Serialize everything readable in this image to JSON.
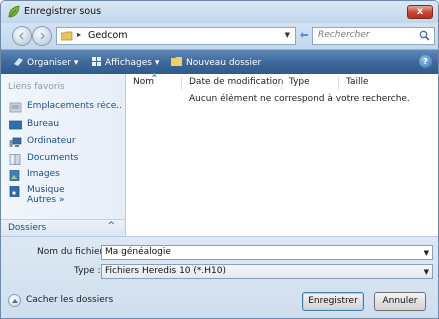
{
  "window": {
    "title": "Enregistrer sous",
    "close_label": "x"
  },
  "address": {
    "path_arrow": "▸",
    "folder": "Gedcom",
    "search_placeholder": "Rechercher"
  },
  "toolbar": {
    "organize": "Organiser",
    "views": "Affichages",
    "new_folder": "Nouveau dossier",
    "help": "?"
  },
  "sidebar": {
    "favorites_title": "Liens favoris",
    "items": [
      {
        "label": "Emplacements réce...",
        "icon": "recent-places-icon"
      },
      {
        "label": "Bureau",
        "icon": "desktop-icon"
      },
      {
        "label": "Ordinateur",
        "icon": "computer-icon"
      },
      {
        "label": "Documents",
        "icon": "documents-icon"
      },
      {
        "label": "Images",
        "icon": "pictures-icon"
      },
      {
        "label": "Musique",
        "icon": "music-icon"
      }
    ],
    "more": "Autres »",
    "folders": "Dossiers"
  },
  "content": {
    "columns": [
      "Nom",
      "Date de modification",
      "Type",
      "Taille"
    ],
    "empty_message": "Aucun élément ne correspond à votre recherche."
  },
  "form": {
    "filename_label": "Nom du fichier :",
    "filename_value": "Ma généalogie",
    "type_label": "Type :",
    "type_value": "Fichiers Heredis 10 (*.H10)"
  },
  "footer": {
    "hide_folders": "Cacher les dossiers",
    "save": "Enregistrer",
    "cancel": "Annuler"
  },
  "colors": {
    "toolbar": "#3e6a9c",
    "link": "#1b4f8f",
    "close": "#c9442e"
  }
}
